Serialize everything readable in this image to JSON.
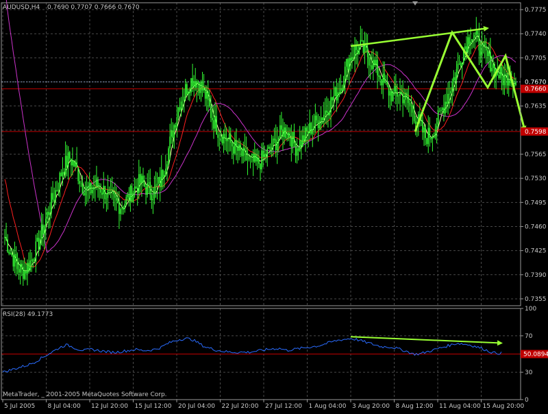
{
  "header": {
    "symbol": "AUDUSD,H4",
    "ohlc": "0.7690 0.7707 0.7666 0.7670"
  },
  "rsi_panel": {
    "label": "RSI(28) 49.1773",
    "current_value_label": "50.0894"
  },
  "footer": {
    "copyright": "MetaTrader, _ 2001-2005 MetaQuotes Software Corp."
  },
  "colors": {
    "background": "#000000",
    "grid": "#4a4a4a",
    "candle": "#33ff33",
    "ma_fast": "#ffffaa",
    "ma_mid": "#ff2020",
    "ma_slow": "#cc33cc",
    "rsi": "#2a6cff",
    "level_line": "#c00000",
    "annotation": "#99ff33",
    "text": "#c8c8c8"
  },
  "chart_data": [
    {
      "type": "candlestick",
      "symbol": "AUDUSD",
      "timeframe": "H4",
      "ylim": [
        0.7345,
        0.7785
      ],
      "y_ticks": [
        "0.7775",
        "0.7740",
        "0.7705",
        "0.7670",
        "0.7635",
        "0.7600",
        "0.7565",
        "0.7530",
        "0.7495",
        "0.7460",
        "0.7425",
        "0.7390",
        "0.7355"
      ],
      "x_ticks": [
        "5 Jul 2005",
        "8 Jul 04:00",
        "12 Jul 20:00",
        "15 Jul 12:00",
        "20 Jul 04:00",
        "22 Jul 20:00",
        "27 Jul 12:00",
        "1 Aug 04:00",
        "3 Aug 20:00",
        "8 Aug 12:00",
        "11 Aug 04:00",
        "15 Aug 20:00"
      ],
      "price_tags": [
        {
          "label": "0.7670",
          "value": 0.767,
          "kind": "current"
        },
        {
          "label": "0.7660",
          "value": 0.766,
          "kind": "level"
        },
        {
          "label": "0.7598",
          "value": 0.7598,
          "kind": "level"
        }
      ],
      "close_path": [
        0.7445,
        0.742,
        0.74,
        0.7395,
        0.741,
        0.743,
        0.746,
        0.749,
        0.7515,
        0.7545,
        0.756,
        0.7545,
        0.752,
        0.751,
        0.752,
        0.7515,
        0.7505,
        0.7495,
        0.749,
        0.75,
        0.7515,
        0.7525,
        0.7515,
        0.751,
        0.7525,
        0.756,
        0.76,
        0.764,
        0.766,
        0.7675,
        0.767,
        0.765,
        0.762,
        0.76,
        0.759,
        0.758,
        0.757,
        0.756,
        0.7555,
        0.755,
        0.756,
        0.757,
        0.7585,
        0.76,
        0.7595,
        0.7575,
        0.7585,
        0.76,
        0.761,
        0.762,
        0.7635,
        0.765,
        0.7665,
        0.77,
        0.7715,
        0.772,
        0.771,
        0.7695,
        0.768,
        0.766,
        0.765,
        0.7655,
        0.7645,
        0.763,
        0.761,
        0.759,
        0.7595,
        0.7615,
        0.764,
        0.7665,
        0.769,
        0.772,
        0.774,
        0.773,
        0.7715,
        0.77,
        0.7685,
        0.7675,
        0.768,
        0.767
      ]
    },
    {
      "type": "line",
      "name": "RSI(28)",
      "ylim": [
        0,
        100
      ],
      "y_ticks": [
        "100",
        "70",
        "50",
        "30",
        "0"
      ],
      "levels": [
        50
      ],
      "values": [
        30,
        32,
        34,
        36,
        38,
        41,
        45,
        49,
        53,
        57,
        60,
        58,
        55,
        54,
        55,
        54,
        53,
        52,
        52,
        53,
        54,
        55,
        54,
        54,
        55,
        57,
        61,
        64,
        66,
        67,
        66,
        62,
        58,
        56,
        54,
        53,
        52,
        52,
        52,
        52,
        53,
        54,
        55,
        56,
        56,
        54,
        55,
        56,
        57,
        58,
        59,
        61,
        63,
        65,
        66,
        67,
        66,
        64,
        62,
        60,
        58,
        58,
        57,
        55,
        53,
        50,
        50,
        52,
        54,
        56,
        58,
        60,
        62,
        61,
        60,
        58,
        56,
        53,
        51,
        51
      ]
    },
    {
      "type": "annotation",
      "items": [
        {
          "kind": "arrow",
          "from": [
            "3 Aug 20:00",
            0.7722
          ],
          "to": [
            "15 Aug 20:00",
            0.7748
          ]
        },
        {
          "kind": "zigzag",
          "points": [
            [
              "8 Aug 12:00",
              0.7598
            ],
            [
              "11 Aug 04:00",
              0.7742
            ],
            [
              "13 Aug",
              0.7662
            ],
            [
              "15 Aug 20:00",
              0.7708
            ],
            [
              "16 Aug",
              0.76
            ]
          ]
        },
        {
          "kind": "arrow",
          "from": [
            "3 Aug 20:00",
            69
          ],
          "to": [
            "15 Aug 20:00",
            62
          ],
          "panel": "rsi"
        }
      ]
    }
  ]
}
